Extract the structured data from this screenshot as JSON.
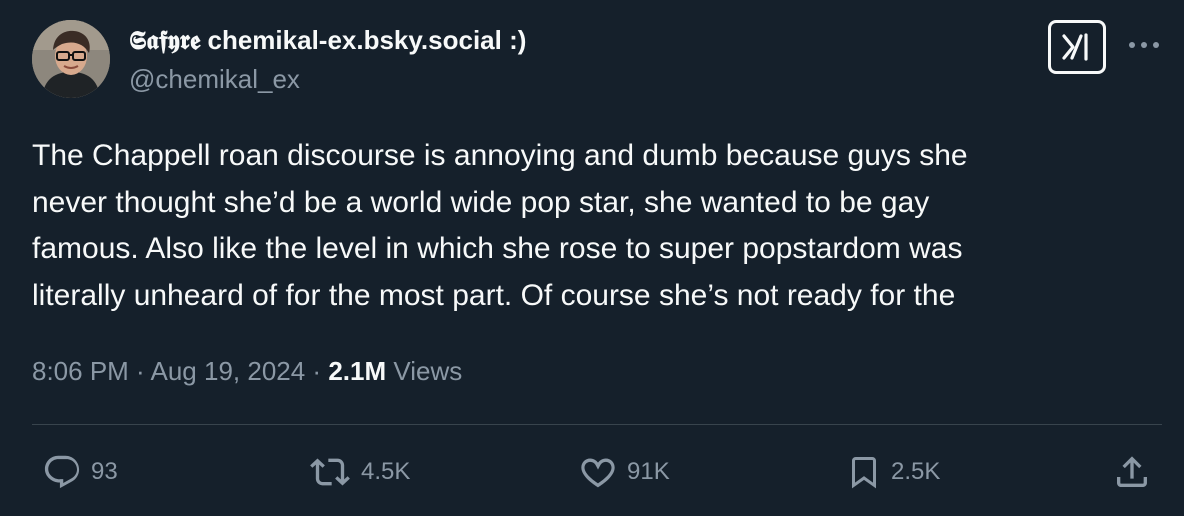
{
  "author": {
    "name_fraktur": "𝕾𝖆𝖋𝖞𝖗𝖊",
    "name_rest": " chemikal-ex.bsky.social :)",
    "handle": "@chemikal_ex"
  },
  "tweet": {
    "lines": [
      "The Chappell roan discourse is annoying and dumb because guys she",
      "never thought she’d be a world wide pop star, she wanted to be gay",
      "famous. Also like the level in which she rose to super popstardom was",
      "literally unheard of for the most part. Of course she’s not ready for the"
    ]
  },
  "meta": {
    "time": "8:06 PM",
    "separator1": " · ",
    "date": "Aug 19, 2024",
    "separator2": " · ",
    "views_count": "2.1M",
    "views_label": " Views"
  },
  "actions": {
    "replies": "93",
    "reposts": "4.5K",
    "likes": "91K",
    "bookmarks": "2.5K"
  },
  "icons": {
    "grok": "grok-icon",
    "more": "more-icon",
    "reply": "reply-icon",
    "repost": "repost-icon",
    "like": "heart-icon",
    "bookmark": "bookmark-icon",
    "share": "share-icon"
  },
  "colors": {
    "background": "#15202b",
    "primary_text": "#f7f9f9",
    "secondary_text": "#8b98a5",
    "divider": "#38444d"
  }
}
